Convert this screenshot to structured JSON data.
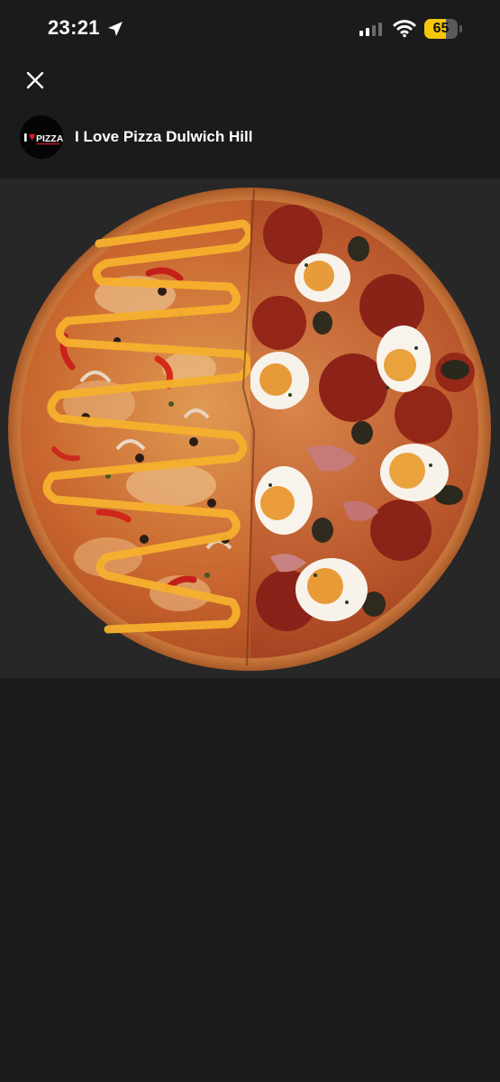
{
  "status_bar": {
    "time": "23:21",
    "battery_level": "65",
    "battery_fraction": 0.65,
    "icons": [
      "location-arrow-icon",
      "cellular-signal-icon",
      "wifi-icon",
      "battery-icon"
    ]
  },
  "header": {
    "close_icon": "close-icon",
    "store_name": "I Love Pizza Dulwich Hill",
    "avatar": {
      "logo_text": "I PIZZA",
      "accent_color": "#d51a25"
    }
  },
  "media": {
    "kind": "photo",
    "subject": "half-and-half pizza",
    "background_color": "#272727"
  },
  "colors": {
    "background": "#1b1b1b",
    "text": "#ffffff",
    "battery": "#f4c70b"
  }
}
